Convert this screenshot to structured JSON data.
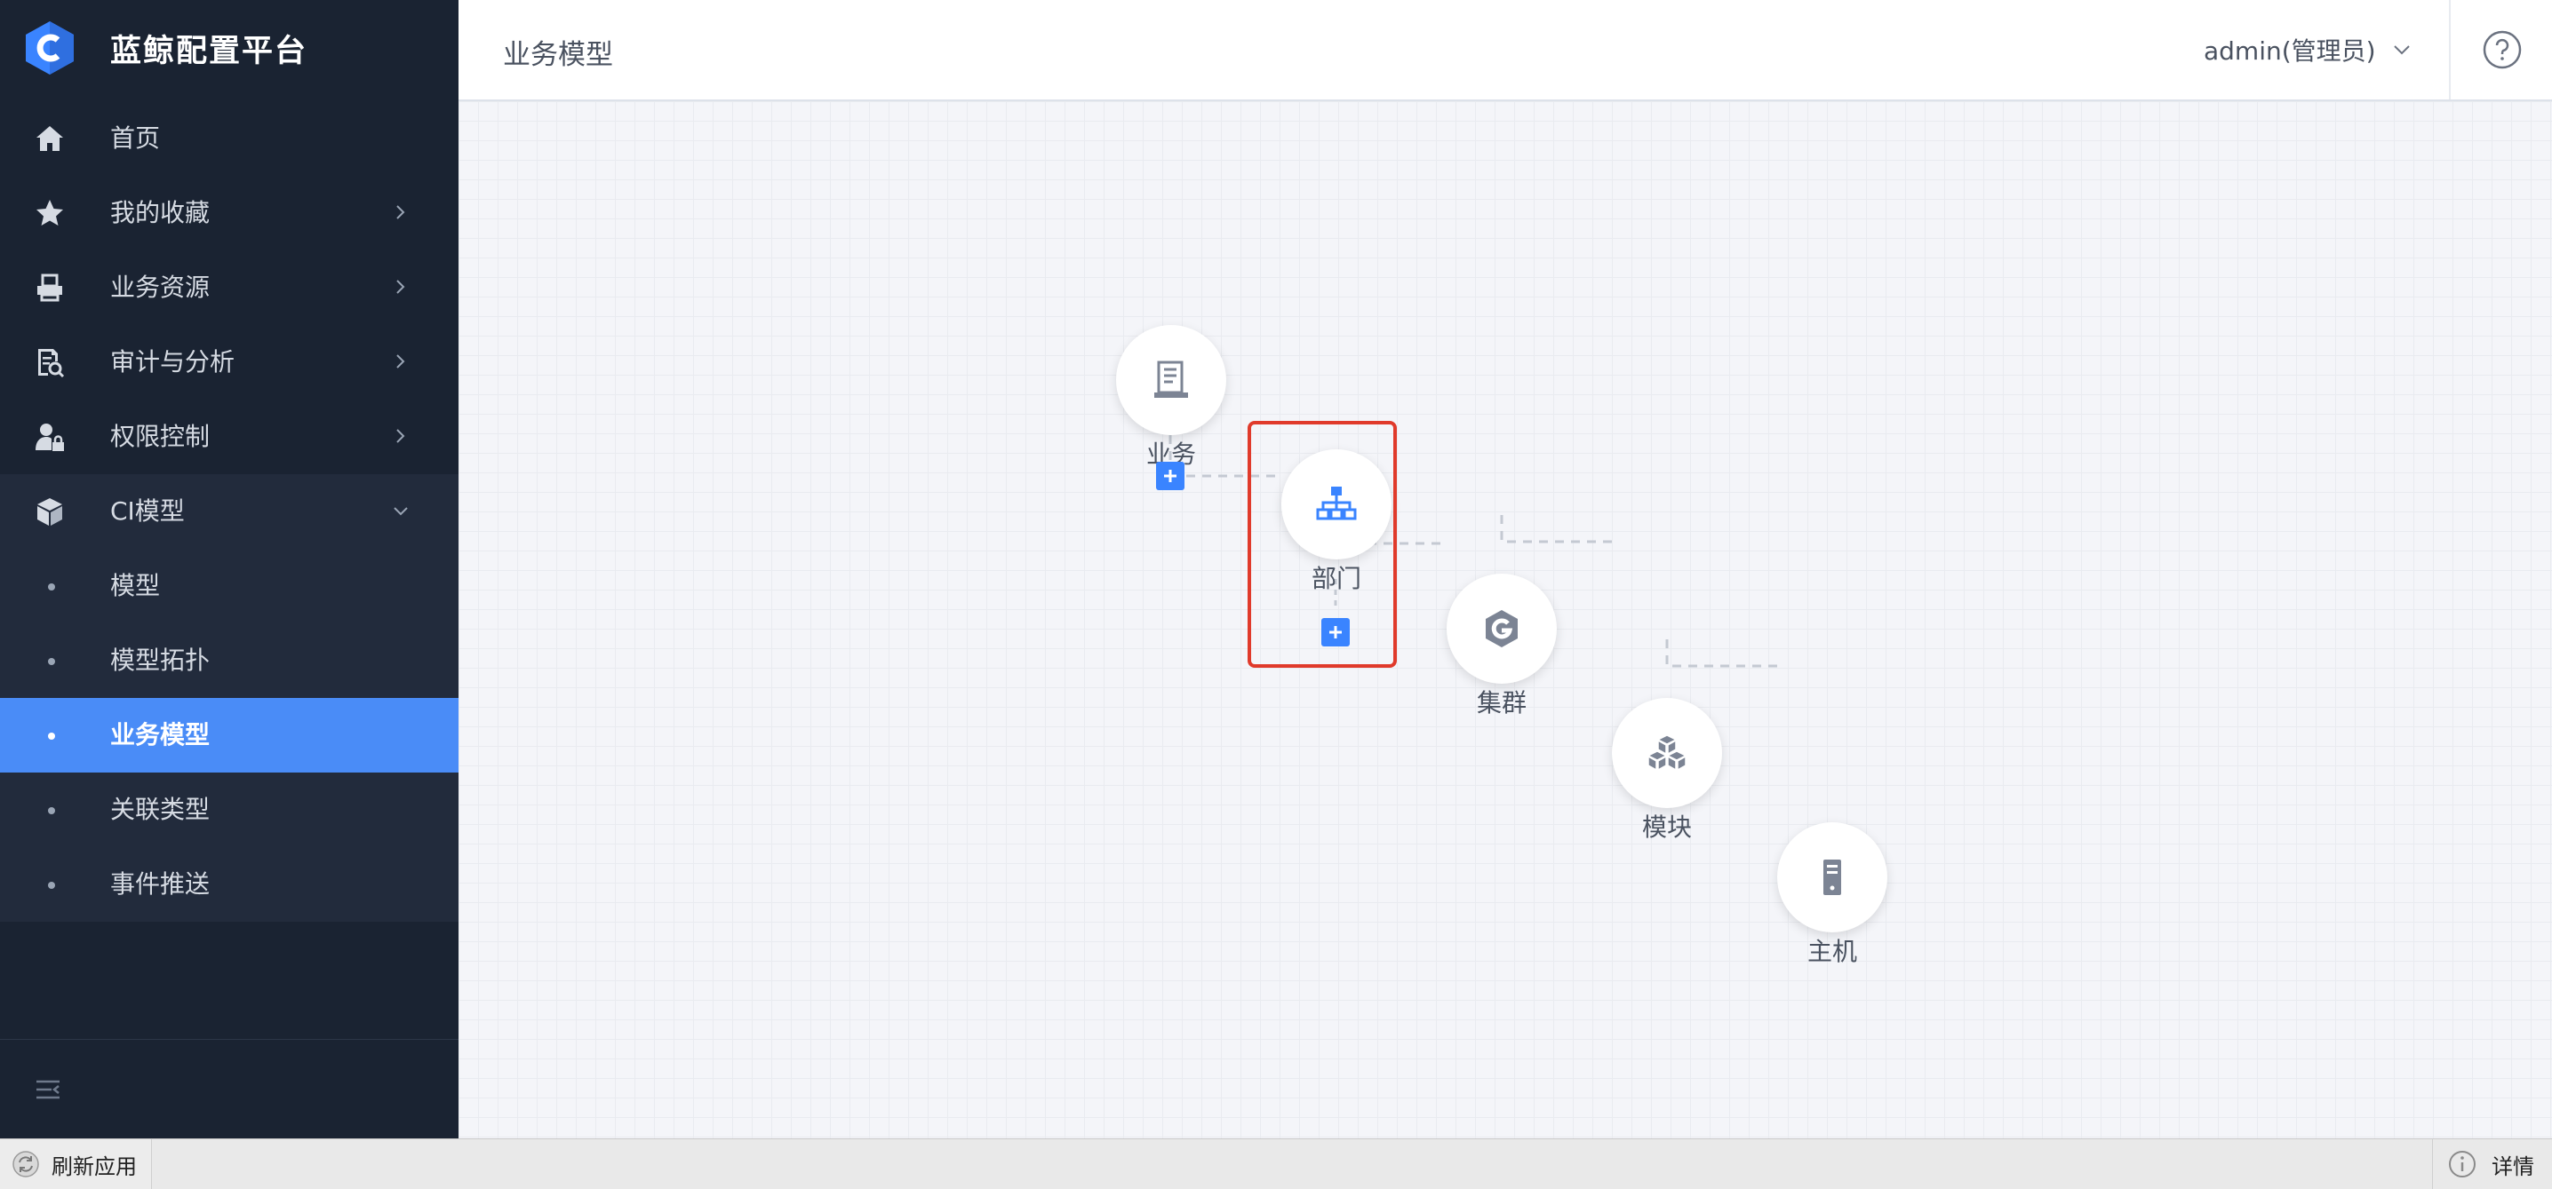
{
  "app": {
    "title": "蓝鲸配置平台",
    "logo_icon": "bk-cmdb-logo-icon"
  },
  "sidebar": {
    "items": [
      {
        "label": "首页",
        "icon": "home-icon"
      },
      {
        "label": "我的收藏",
        "icon": "star-icon",
        "expandable": true
      },
      {
        "label": "业务资源",
        "icon": "printer-icon",
        "expandable": true
      },
      {
        "label": "审计与分析",
        "icon": "audit-icon",
        "expandable": true
      },
      {
        "label": "权限控制",
        "icon": "user-lock-icon",
        "expandable": true
      },
      {
        "label": "CI模型",
        "icon": "cube-icon",
        "expanded": true
      }
    ],
    "sub_items": [
      {
        "label": "模型"
      },
      {
        "label": "模型拓扑"
      },
      {
        "label": "业务模型",
        "active": true
      },
      {
        "label": "关联类型"
      },
      {
        "label": "事件推送"
      }
    ],
    "collapse_icon": "collapse-menu-icon"
  },
  "header": {
    "breadcrumb": "业务模型",
    "user": "admin(管理员)",
    "help_icon": "question-circle-icon"
  },
  "topology": {
    "nodes": [
      {
        "label": "业务",
        "icon": "business-icon"
      },
      {
        "label": "部门",
        "icon": "org-chart-icon"
      },
      {
        "label": "集群",
        "icon": "cluster-g-icon"
      },
      {
        "label": "模块",
        "icon": "cubes-icon"
      },
      {
        "label": "主机",
        "icon": "server-icon"
      }
    ],
    "highlighted_node": "部门"
  },
  "bottom_bar": {
    "refresh_label": "刷新应用",
    "details_label": "详情"
  },
  "colors": {
    "sidebar_bg": "#1a2332",
    "submenu_bg": "#222b3c",
    "accent": "#4a8cf7",
    "plus_button": "#3a84ff",
    "highlight_border": "#e03a2b"
  }
}
